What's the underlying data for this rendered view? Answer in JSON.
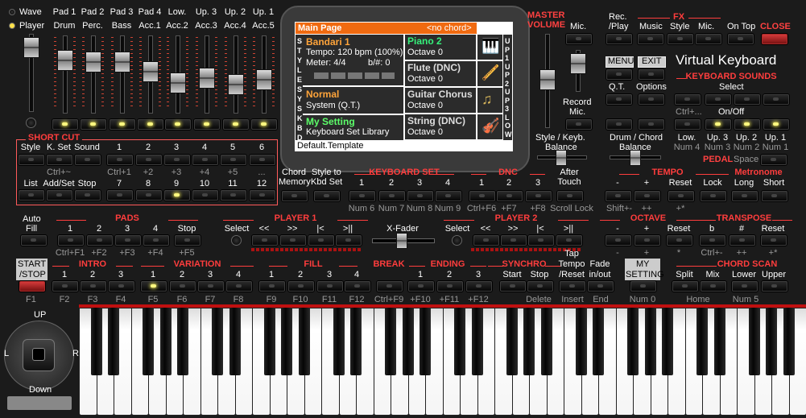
{
  "top_left": {
    "wave": "Wave",
    "player": "Player"
  },
  "mixer": {
    "top": [
      "Pad 1",
      "Pad 2",
      "Pad 3",
      "Pad 4",
      "Low.",
      "Up. 3",
      "Up. 2",
      "Up. 1"
    ],
    "bottom": [
      "Drum",
      "Perc.",
      "Bass",
      "Acc.1",
      "Acc.2",
      "Acc.3",
      "Acc.4",
      "Acc.5"
    ]
  },
  "shortcut": {
    "title": "SHORT CUT",
    "row1": [
      "Style",
      "K. Set",
      "Sound",
      "1",
      "2",
      "3",
      "4",
      "5",
      "6"
    ],
    "row1_sub": [
      "Ctrl+~",
      "",
      "Ctrl+1",
      "+2",
      "+3",
      "+4",
      "+5",
      "..."
    ],
    "row2": [
      "List",
      "Add/Set",
      "Stop",
      "7",
      "8",
      "9",
      "10",
      "11",
      "12"
    ]
  },
  "screen": {
    "main_page": "Main Page",
    "chord": "<no chord>",
    "style_name": "Bandari 1",
    "tempo": "Tempo: 120 bpm (100%)",
    "meter": "Meter: 4/4",
    "bsharp": "b/#:  0",
    "sys_name": "Normal",
    "sys_sub": "System (Q.T.)",
    "kbd_name": "My Setting",
    "kbd_sub": "Keyboard Set Library",
    "footer": "Default.Template",
    "side_left": [
      "S",
      "T",
      "Y",
      "L",
      "E",
      "S",
      "Y",
      "S",
      "K",
      "B",
      "D"
    ],
    "side_right": [
      "U",
      "P",
      "1",
      "U",
      "P",
      "2",
      "U",
      "P",
      "3",
      "L",
      "O",
      "W"
    ],
    "voices": [
      {
        "name": "Piano 2",
        "octave": "Octave 0",
        "icon": "piano-icon"
      },
      {
        "name": "Flute (DNC)",
        "octave": "Octave 0",
        "icon": "flute-icon"
      },
      {
        "name": "Guitar Chorus",
        "octave": "Octave 0",
        "icon": "music-note-icon"
      },
      {
        "name": "String (DNC)",
        "octave": "Octave 0",
        "icon": "violin-icon"
      }
    ]
  },
  "master": {
    "line1": "MASTER",
    "line2": "VOLUME",
    "mic": "Mic.",
    "record": "Record",
    "record_mic": "Mic.",
    "style_kbd": "Style / Keyb.",
    "balance": "Balance",
    "drum_chord": "Drum / Chord",
    "balance2": "Balance"
  },
  "right_top": {
    "rec_play": "Rec.",
    "rec_play2": "/Play",
    "fx": "FX",
    "music": "Music",
    "style": "Style",
    "mic": "Mic.",
    "on_top": "On Top",
    "close": "CLOSE",
    "menu": "MENU",
    "exit": "EXIT",
    "title": "Virtual Keyboard",
    "qt": "Q.T.",
    "options": "Options"
  },
  "keyboard_sounds": {
    "title": "KEYBOARD SOUNDS",
    "select": "Select",
    "ctrl": "Ctrl+...",
    "onoff": "On/Off",
    "labels": [
      "Low.",
      "Up. 3",
      "Up. 2",
      "Up. 1"
    ],
    "nums": [
      "Num 4",
      "Num 3",
      "Num 2",
      "Num 1"
    ],
    "pedal": "PEDAL",
    "space": "Space"
  },
  "chord_memory": {
    "l1": "Chord",
    "l2": "Memory",
    "style_to": "Style to",
    "kbd_set": "Kbd Set"
  },
  "keyboard_set": {
    "title": "KEYBOARD SET",
    "nums": [
      "1",
      "2",
      "3",
      "4"
    ],
    "keys": [
      "Num 6",
      "Num 7",
      "Num 8",
      "Num 9"
    ]
  },
  "dnc": {
    "title": "DNC",
    "nums": [
      "1",
      "2",
      "3"
    ],
    "keys": [
      "Ctrl+F6",
      "+F7",
      "+F8"
    ]
  },
  "after_touch": {
    "l1": "After",
    "l2": "Touch",
    "key": "Scroll Lock"
  },
  "tempo": {
    "title": "TEMPO",
    "labels": [
      "-",
      "+",
      "Reset",
      "Lock"
    ],
    "keys": [
      "Shift+-",
      "++",
      "+*"
    ]
  },
  "metronome": {
    "title": "Metronome",
    "labels": [
      "Long",
      "Short"
    ]
  },
  "autofill": {
    "l1": "Auto",
    "l2": "Fill"
  },
  "pads": {
    "title": "PADS",
    "labels": [
      "1",
      "2",
      "3",
      "4",
      "Stop"
    ],
    "keys": [
      "Ctrl+F1",
      "+F2",
      "+F3",
      "+F4",
      "+F5"
    ]
  },
  "player1": {
    "title": "PLAYER 1",
    "labels": [
      "Select",
      "<<",
      ">>",
      "|<",
      ">||"
    ]
  },
  "xfader": "X-Fader",
  "player2": {
    "title": "PLAYER 2",
    "labels": [
      "Select",
      "<<",
      ">>",
      "|<",
      ">||"
    ]
  },
  "octave": {
    "title": "OCTAVE",
    "labels": [
      "-",
      "+",
      "Reset"
    ],
    "keys": [
      "-",
      "+",
      "*"
    ]
  },
  "transpose": {
    "title": "TRANSPOSE",
    "labels": [
      "b",
      "#",
      "Reset"
    ],
    "keys": [
      "Ctrl+-",
      "++",
      "+*"
    ]
  },
  "start_stop": {
    "l1": "START",
    "l2": "/STOP",
    "key": "F1"
  },
  "intro": {
    "title": "INTRO",
    "labels": [
      "1",
      "2",
      "3"
    ],
    "keys": [
      "F2",
      "F3",
      "F4"
    ]
  },
  "variation": {
    "title": "VARIATION",
    "labels": [
      "1",
      "2",
      "3",
      "4"
    ],
    "keys": [
      "F5",
      "F6",
      "F7",
      "F8"
    ]
  },
  "fill": {
    "title": "FILL",
    "labels": [
      "1",
      "2",
      "3",
      "4"
    ],
    "keys": [
      "F9",
      "F10",
      "F11",
      "F12"
    ]
  },
  "break": {
    "title": "BREAK",
    "key": "Ctrl+F9"
  },
  "ending": {
    "title": "ENDING",
    "labels": [
      "1",
      "2",
      "3"
    ],
    "keys": [
      "+F10",
      "+F11",
      "+F12"
    ]
  },
  "synchro": {
    "title": "SYNCHRO",
    "labels": [
      "Start",
      "Stop"
    ],
    "key": "Delete"
  },
  "tap": {
    "l1": "Tap",
    "l2": "Tempo",
    "l3": "/Reset",
    "key": "Insert"
  },
  "fade": {
    "l1": "Fade",
    "l2": "in/out",
    "key": "End"
  },
  "my_setting": {
    "l1": "MY",
    "l2": "SETTING",
    "key": "Num 0"
  },
  "chord_scan": {
    "title": "CHORD SCAN",
    "labels": [
      "Split",
      "Mix",
      "Lower",
      "Upper"
    ],
    "key_home": "Home",
    "key_num5": "Num 5"
  },
  "joystick": {
    "up": "UP",
    "down": "Down",
    "left": "L",
    "right": "R"
  }
}
